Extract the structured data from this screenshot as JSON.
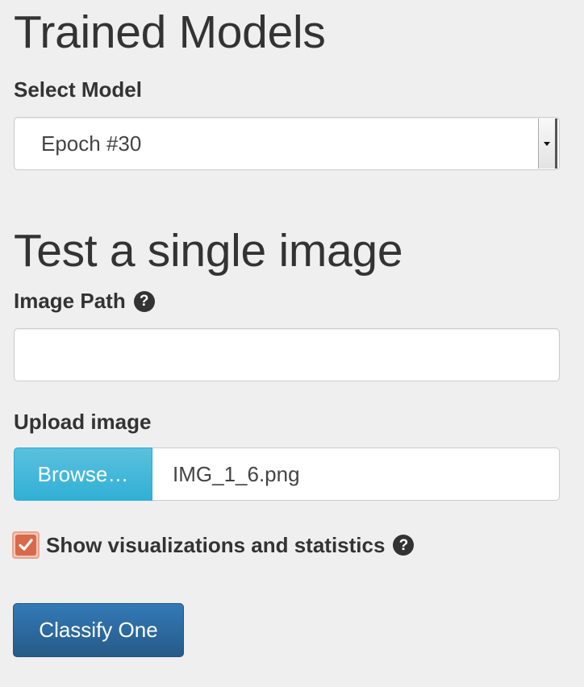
{
  "trained_models": {
    "title": "Trained Models",
    "select_label": "Select Model",
    "selected_model": "Epoch #30"
  },
  "test_single": {
    "title": "Test a single image",
    "image_path_label": "Image Path",
    "image_path_value": "",
    "upload_label": "Upload image",
    "browse_label": "Browse…",
    "file_name": "IMG_1_6.png",
    "show_viz_label": "Show visualizations and statistics",
    "show_viz_checked": true,
    "classify_label": "Classify One"
  },
  "icons": {
    "help": "question-circle-icon",
    "select_arrow": "caret-down-icon",
    "check": "checkmark-icon"
  },
  "colors": {
    "browse_button": "#5bc0de",
    "classify_button": "#337ab7",
    "checkbox_fill": "#d9694b"
  }
}
